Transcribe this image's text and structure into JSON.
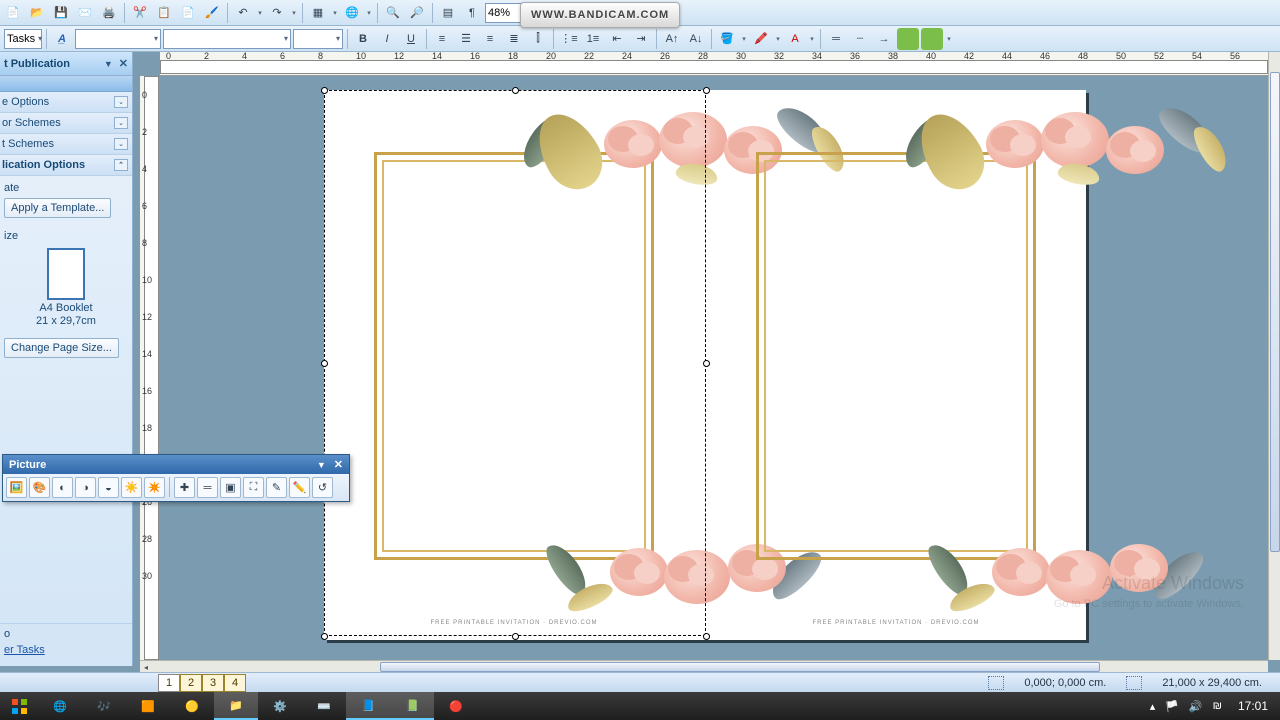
{
  "zoom": "48%",
  "watermark": "WWW.BANDICAM.COM",
  "taskpane": {
    "title": "t Publication",
    "sec_options": "e Options",
    "sec_color": "or Schemes",
    "sec_font": "t Schemes",
    "sec_pub": "lication Options",
    "lbl_template": "ate",
    "btn_template": "Apply a Template...",
    "lbl_size": "ize",
    "thumb_name": "A4 Booklet",
    "thumb_dim": "21 x 29,7cm",
    "btn_pagesize": "Change Page Size...",
    "lbl_also": "o",
    "link_tasks": "er Tasks"
  },
  "picture_toolbar": {
    "title": "Picture"
  },
  "status": {
    "pages": [
      "1",
      "2",
      "3",
      "4"
    ],
    "current_page": 1,
    "coord": "0,000; 0,000 cm.",
    "dims": "21,000 x 29,400 cm."
  },
  "card_credit": "FREE PRINTABLE INVITATION · DREVIO.COM",
  "ghost1": "Activate Windows",
  "ghost2": "Go to PC settings to activate Windows.",
  "tray": {
    "time": "17:01"
  },
  "hruler_nums": [
    0,
    2,
    4,
    6,
    8,
    10,
    12,
    14,
    16,
    18,
    20,
    22,
    24,
    26,
    28,
    30,
    32,
    34,
    36,
    38,
    40,
    42,
    44,
    46,
    48,
    50,
    52,
    54,
    56
  ],
  "vruler_nums": [
    0,
    2,
    4,
    6,
    8,
    10,
    12,
    14,
    16,
    18,
    24,
    26,
    28,
    30
  ]
}
